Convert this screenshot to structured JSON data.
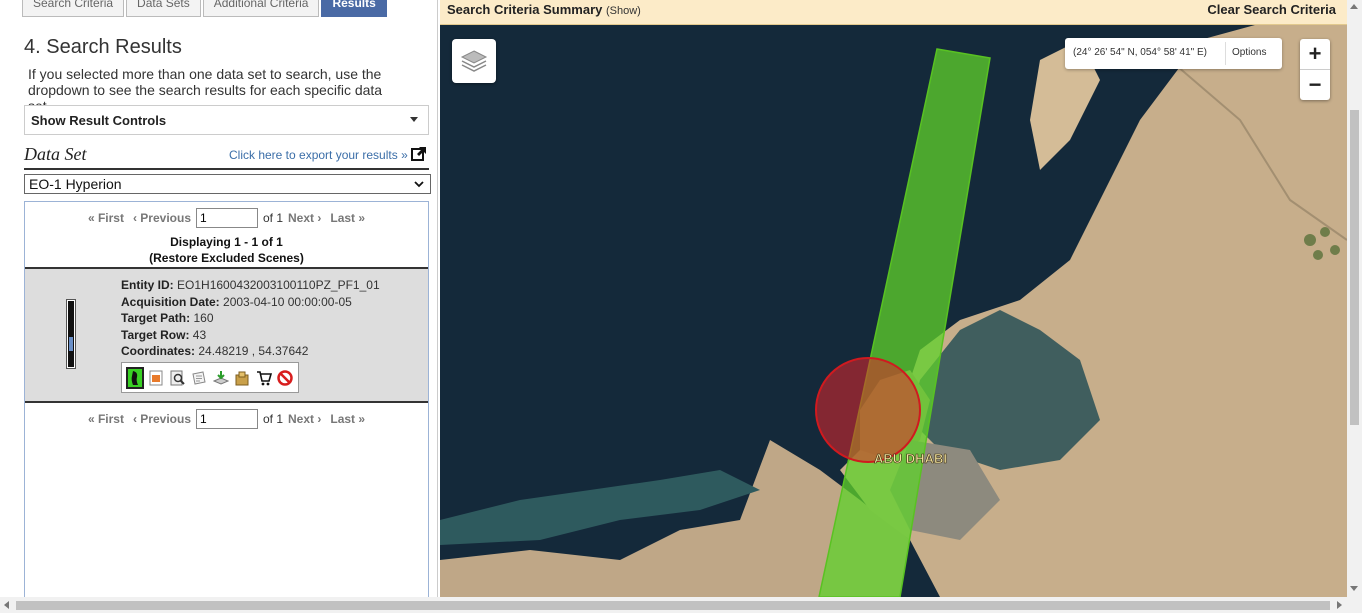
{
  "tabs": [
    "Search Criteria",
    "Data Sets",
    "Additional Criteria",
    "Results"
  ],
  "panel": {
    "title": "4. Search Results",
    "description": "If you selected more than one data set to search, use the dropdown to see the search results for each specific data set.",
    "result_controls_label": "Show Result Controls",
    "dataset_label": "Data Set",
    "export_link": "Click here to export your results »",
    "dataset_selected": "EO-1 Hyperion"
  },
  "pager": {
    "first": "« First",
    "previous": "‹ Previous",
    "page_value": "1",
    "of_text": "of 1",
    "next": "Next ›",
    "last": "Last »"
  },
  "results_summary": {
    "displaying": "Displaying 1 - 1 of 1",
    "restore": "(Restore Excluded Scenes)"
  },
  "result": {
    "entity_label": "Entity ID:",
    "entity_value": "EO1H1600432003100110PZ_PF1_01",
    "acq_label": "Acquisition Date:",
    "acq_value": "2003-04-10 00:00:00-05",
    "path_label": "Target Path:",
    "path_value": "160",
    "row_label": "Target Row:",
    "row_value": "43",
    "coord_label": "Coordinates:",
    "coord_value": "24.48219 , 54.37642"
  },
  "toolbar_icons": [
    "footprint-icon",
    "overlay-icon",
    "browse-icon",
    "metadata-icon",
    "download-icon",
    "bulk-download-icon",
    "cart-icon",
    "exclude-icon"
  ],
  "map": {
    "summary_title": "Search Criteria Summary",
    "summary_show": "(Show)",
    "clear": "Clear Search Criteria",
    "coords": "(24° 26' 54\" N, 054° 58' 41\" E)",
    "options": "Options",
    "zoom_in": "+",
    "zoom_out": "−",
    "city_label": "ABU DHABI"
  },
  "colors": {
    "active_tab": "#4a6aa5",
    "link": "#3b6ea8",
    "footprint": "#5fd12b",
    "point_marker": "#e0262b",
    "summary_bar": "#fcebc8"
  }
}
